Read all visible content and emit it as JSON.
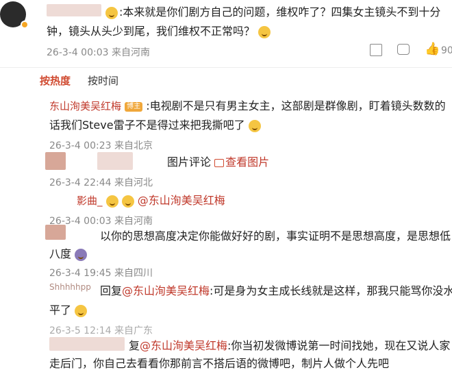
{
  "top_comment": {
    "text_line1": ":本来就是你们剧方自己的问题，维权咋了？四集女主镜头不到十分",
    "text_line2": "钟，镜头从头少到尾，我们维权不正常吗？",
    "meta": "26-3-4 00:03 来自河南",
    "like_count": "90"
  },
  "sort_tabs": {
    "hot": "按热度",
    "time": "按时间"
  },
  "comments": [
    {
      "user": "东山洵美吴红梅",
      "badge": "博主",
      "line1": ":电视剧不是只有男主女主，这部剧是群像剧，盯着镜头数数的",
      "line2": "话我们Steve雷子不是得过来把我撕吧了",
      "meta": "26-3-4 00:23 来自北京"
    },
    {
      "frag": "图片评论",
      "view_image": "查看图片",
      "meta": "26-3-4 22:44 来自河北"
    },
    {
      "user_partial": "影曲_",
      "reply": "@东山洵美吴红梅",
      "meta": "26-3-4 00:03 来自河南"
    },
    {
      "line1": "以你的思想高度决定你能做好好的剧，事实证明不是思想高度，是思想低",
      "line2": "八度",
      "meta": "26-3-4 19:45 来自四川"
    },
    {
      "user_partial": "Shhhhhpp",
      "reply_prefix": "回复",
      "reply": "@东山洵美吴红梅",
      "line1": ":可是身为女主成长线就是这样，那我只能骂你没水",
      "line2": "平了",
      "meta": "26-3-5 12:14 来自广东"
    },
    {
      "reply_prefix": "复",
      "reply": "@东山洵美吴红梅",
      "line1": ":你当初发微博说第一时间找她，现在又说人家",
      "line2": "走后门，你自己去看看你那前言不搭后语的微博吧，制片人做个人先吧"
    }
  ]
}
